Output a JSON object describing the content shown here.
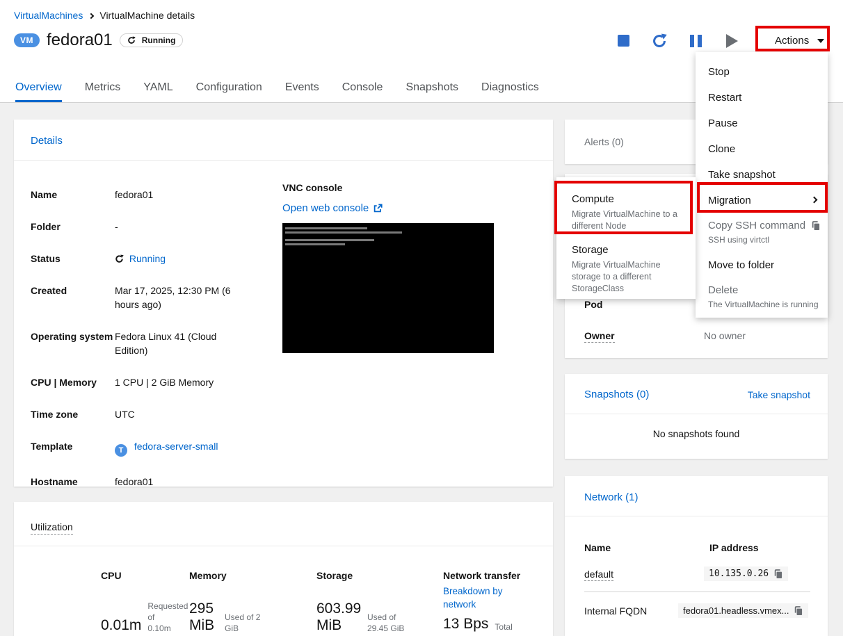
{
  "colors": {
    "accent_blue": "#0066cc",
    "annotation_red": "#e40000",
    "badge_blue": "#4a90e2",
    "text": "#151515",
    "muted": "#6a6e73",
    "page_background": "#f0f0f0"
  },
  "breadcrumb": {
    "link": "VirtualMachines",
    "current": "VirtualMachine details"
  },
  "header": {
    "badge": "VM",
    "title": "fedora01",
    "status": "Running",
    "actions_button": "Actions"
  },
  "tabs": {
    "active": "Overview",
    "items": [
      "Overview",
      "Metrics",
      "YAML",
      "Configuration",
      "Events",
      "Console",
      "Snapshots",
      "Diagnostics"
    ]
  },
  "details": {
    "title": "Details",
    "fields": [
      {
        "label": "Name",
        "value": "fedora01"
      },
      {
        "label": "Folder",
        "value": "-"
      },
      {
        "label": "Status",
        "value": "Running"
      },
      {
        "label": "Created",
        "value": "Mar 17, 2025, 12:30 PM (6 hours ago)"
      },
      {
        "label": "Operating system",
        "value": "Fedora Linux 41 (Cloud Edition)"
      },
      {
        "label": "CPU | Memory",
        "value": "1 CPU | 2 GiB Memory"
      },
      {
        "label": "Time zone",
        "value": "UTC"
      },
      {
        "label": "Template",
        "value": "fedora-server-small"
      },
      {
        "label": "Hostname",
        "value": "fedora01"
      }
    ],
    "vnc": {
      "title": "VNC console",
      "open_link": "Open web console"
    }
  },
  "utilization": {
    "title": "Utilization",
    "cpu": {
      "name": "CPU",
      "value": "0.01m",
      "sub": "Requested of 0.10m"
    },
    "memory": {
      "name": "Memory",
      "value": "295 MiB",
      "sub": "Used of 2 GiB"
    },
    "storage": {
      "name": "Storage",
      "value": "603.99 MiB",
      "sub": "Used of 29.45 GiB"
    },
    "network": {
      "name": "Network transfer",
      "link": "Breakdown by network",
      "value": "13 Bps",
      "sub": "Total"
    }
  },
  "alerts": {
    "title": "Alerts (0)"
  },
  "general": {
    "pod_label": "Pod",
    "owner_label": "Owner",
    "owner_value": "No owner"
  },
  "snapshots": {
    "title": "Snapshots (0)",
    "action": "Take snapshot",
    "empty": "No snapshots found"
  },
  "network": {
    "title": "Network (1)",
    "col_name": "Name",
    "col_ip": "IP address",
    "rows": [
      {
        "name": "default",
        "value": "10.135.0.26"
      },
      {
        "name": "Internal FQDN",
        "value": "fedora01.headless.vmex..."
      }
    ]
  },
  "actions_menu": {
    "items": [
      {
        "label": "Stop"
      },
      {
        "label": "Restart"
      },
      {
        "label": "Pause"
      },
      {
        "label": "Clone"
      },
      {
        "label": "Take snapshot"
      },
      {
        "label": "Migration"
      },
      {
        "label": "Copy SSH command",
        "description": "SSH using virtctl"
      },
      {
        "label": "Move to folder"
      },
      {
        "label": "Delete",
        "description": "The VirtualMachine is running"
      }
    ]
  },
  "migration_submenu": {
    "items": [
      {
        "label": "Compute",
        "description": "Migrate VirtualMachine to a different Node"
      },
      {
        "label": "Storage",
        "description": "Migrate VirtualMachine storage to a different StorageClass"
      }
    ]
  }
}
